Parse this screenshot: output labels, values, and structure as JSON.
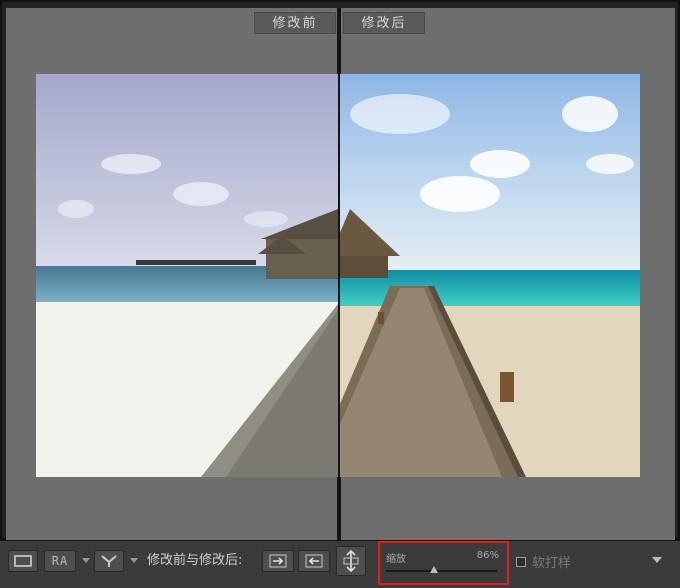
{
  "viewer": {
    "before_label": "修改前",
    "after_label": "修改后"
  },
  "toolbar": {
    "view_single_icon": "single-view-icon",
    "view_ra_label": "RA",
    "view_split_icon": "y-split-icon",
    "compare_label": "修改前与修改后:",
    "copy_to_after_icon": "arrow-right-icon",
    "copy_to_before_icon": "arrow-left-icon",
    "swap_icon": "swap-icon",
    "zoom_label": "缩放",
    "zoom_value": "86%",
    "zoom_level": 0.86,
    "soft_proof_label": "软打样",
    "soft_proof_checked": false,
    "menu_icon": "chevron-down-icon"
  },
  "colors": {
    "highlight": "#e02020",
    "panel": "#6e6e6e",
    "toolbar": "#3b3b3b"
  }
}
